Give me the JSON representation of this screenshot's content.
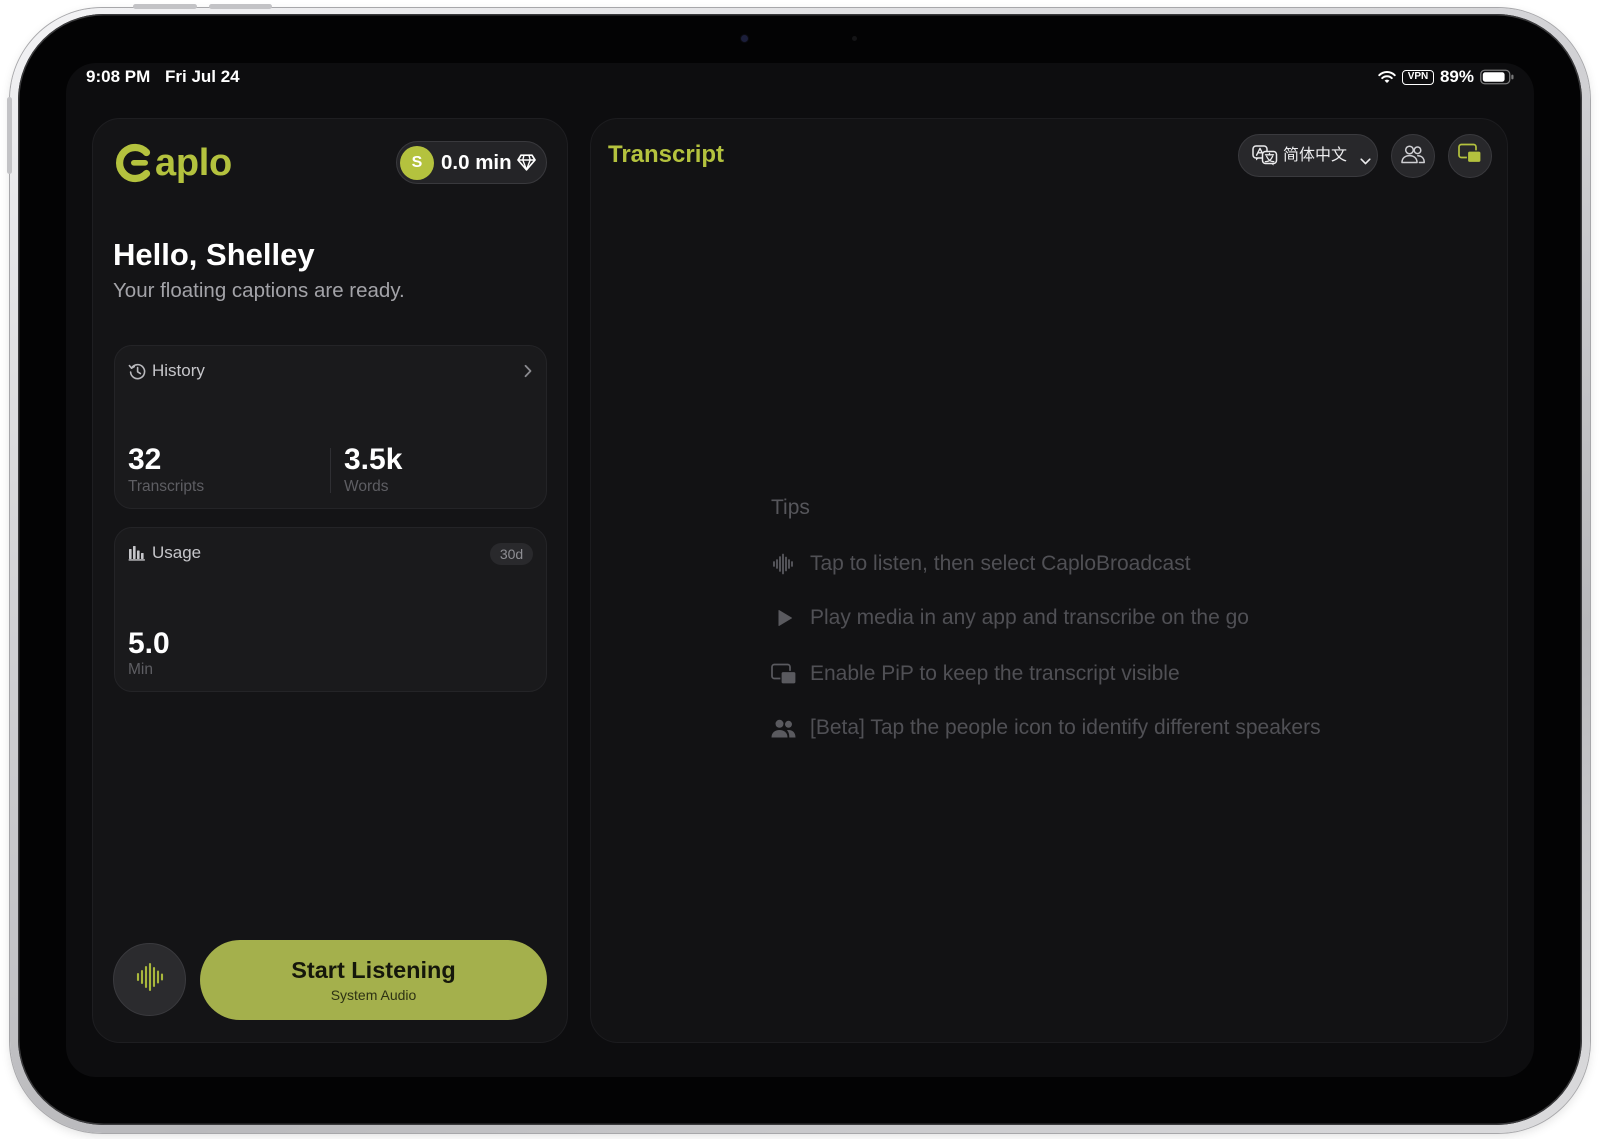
{
  "status_bar": {
    "time": "9:08 PM",
    "date": "Fri Jul 24",
    "vpn_label": "VPN",
    "battery_text": "89%",
    "battery_level": 0.89,
    "icons": [
      "wifi-icon",
      "battery-icon"
    ]
  },
  "brand": {
    "logo": "Caplo",
    "accent_color": "#b4c23e",
    "button_color": "#a4b04c"
  },
  "account": {
    "avatar_initial": "S",
    "balance": "0.0 min",
    "icon": "diamond-icon"
  },
  "greeting": {
    "title": "Hello, Shelley",
    "subtitle": "Your floating captions are ready."
  },
  "history": {
    "label": "History",
    "icon": "history-clock-icon",
    "stats": [
      {
        "value": "32",
        "label": "Transcripts"
      },
      {
        "value": "3.5k",
        "label": "Words"
      }
    ]
  },
  "usage": {
    "label": "Usage",
    "icon": "bar-chart-icon",
    "period": "30d",
    "value": "5.0",
    "unit": "Min"
  },
  "listen": {
    "label": "Start Listening",
    "sublabel": "System Audio",
    "icon": "waveform-icon"
  },
  "transcript": {
    "title": "Transcript",
    "language": "简体中文",
    "buttons": [
      "translate-icon",
      "people-icon",
      "pip-icon"
    ]
  },
  "tips": {
    "title": "Tips",
    "items": [
      {
        "icon": "waveform-icon",
        "text": "Tap to listen, then select CaploBroadcast"
      },
      {
        "icon": "play-icon",
        "text": "Play media in any app and transcribe on the go"
      },
      {
        "icon": "pip-icon",
        "text": "Enable PiP to keep the transcript visible"
      },
      {
        "icon": "people-icon",
        "text": "[Beta] Tap the people icon to identify different speakers"
      }
    ]
  }
}
